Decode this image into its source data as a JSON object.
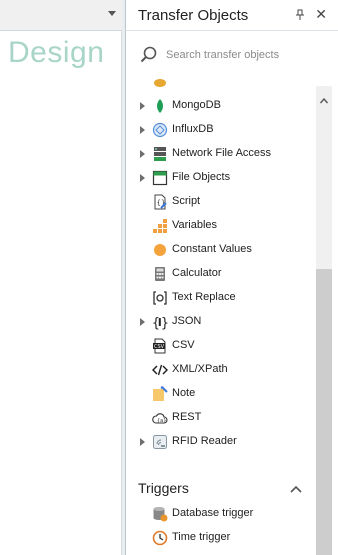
{
  "designer": {
    "tab_label": "Design"
  },
  "panel": {
    "title": "Transfer Objects",
    "search": {
      "placeholder": "Search transfer objects"
    }
  },
  "items": [
    {
      "label": "",
      "icon": "partial-top-icon",
      "expandable": false
    },
    {
      "label": "MongoDB",
      "icon": "mongodb-leaf-icon",
      "expandable": true
    },
    {
      "label": "InfluxDB",
      "icon": "influxdb-icon",
      "expandable": true
    },
    {
      "label": "Network File Access",
      "icon": "network-server-icon",
      "expandable": true
    },
    {
      "label": "File Objects",
      "icon": "file-objects-icon",
      "expandable": true
    },
    {
      "label": "Script",
      "icon": "script-icon",
      "expandable": false
    },
    {
      "label": "Variables",
      "icon": "variables-icon",
      "expandable": false
    },
    {
      "label": "Constant Values",
      "icon": "constant-circle-icon",
      "expandable": false
    },
    {
      "label": "Calculator",
      "icon": "calculator-icon",
      "expandable": false
    },
    {
      "label": "Text Replace",
      "icon": "text-replace-icon",
      "expandable": false
    },
    {
      "label": "JSON",
      "icon": "json-braces-icon",
      "expandable": true
    },
    {
      "label": "CSV",
      "icon": "csv-icon",
      "expandable": false
    },
    {
      "label": "XML/XPath",
      "icon": "xml-tag-icon",
      "expandable": false
    },
    {
      "label": "Note",
      "icon": "note-icon",
      "expandable": false
    },
    {
      "label": "REST",
      "icon": "rest-cloud-icon",
      "expandable": false
    },
    {
      "label": "RFID Reader",
      "icon": "rfid-reader-icon",
      "expandable": true
    }
  ],
  "triggers": {
    "title": "Triggers",
    "items": [
      {
        "label": "Database trigger",
        "icon": "database-trigger-icon"
      },
      {
        "label": "Time trigger",
        "icon": "clock-icon"
      }
    ]
  },
  "colors": {
    "design_text": "#a8d5c8",
    "accent_green": "#1e9e54",
    "accent_orange": "#f0a040"
  }
}
